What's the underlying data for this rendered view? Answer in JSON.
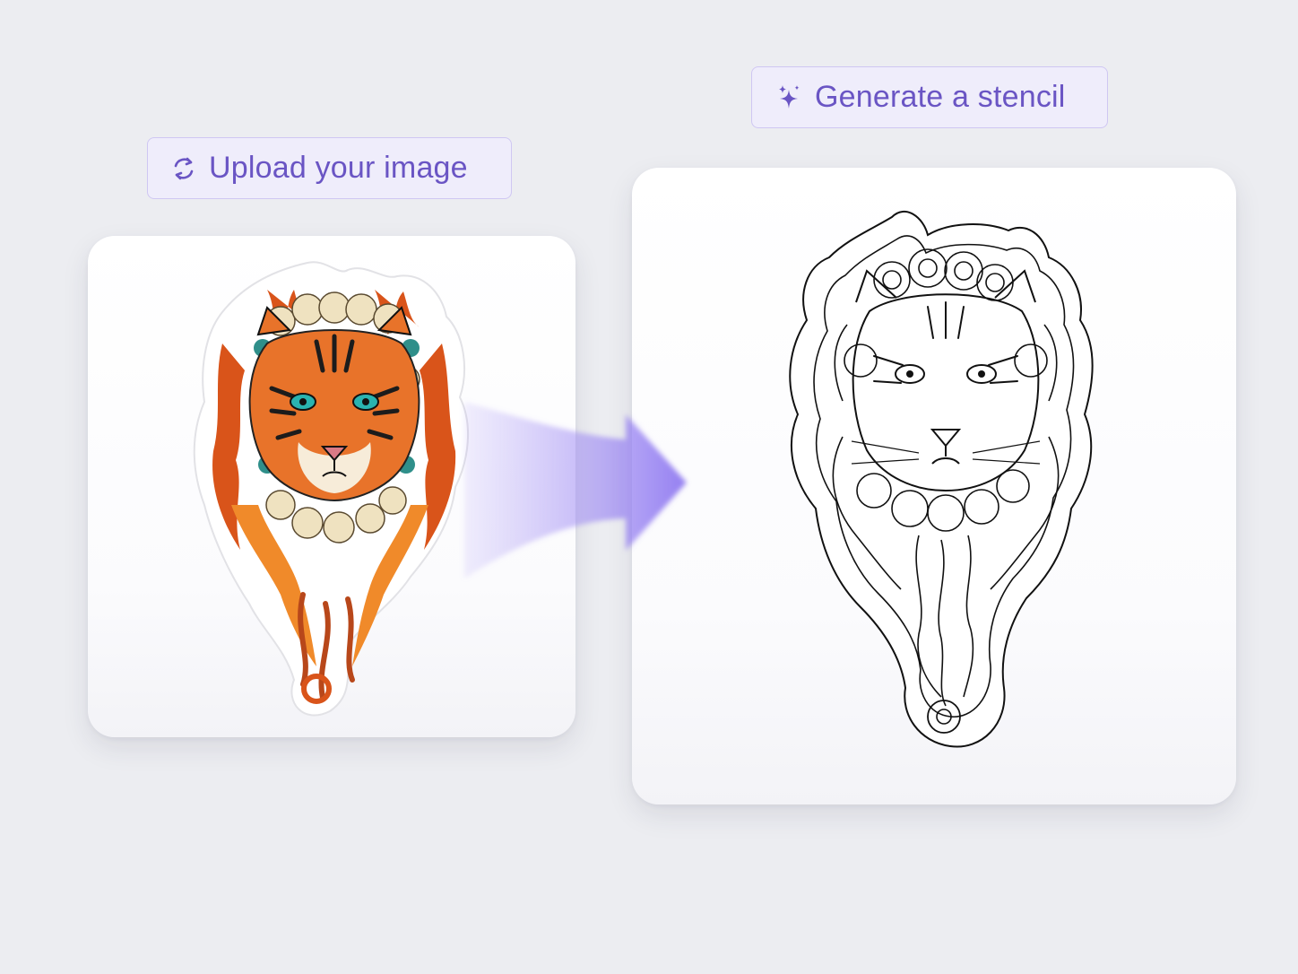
{
  "steps": {
    "upload": {
      "label": "Upload your image",
      "icon": "refresh-icon"
    },
    "generate": {
      "label": "Generate a stencil",
      "icon": "sparkle-icon"
    }
  },
  "cards": {
    "original": {
      "content": "tiger-illustration"
    },
    "stencil": {
      "content": "tiger-stencil-outline"
    }
  },
  "colors": {
    "accent": "#6a55c4",
    "pill_bg": "#efedfb",
    "arrow": "#8f79f0",
    "background": "#ecedf1"
  }
}
